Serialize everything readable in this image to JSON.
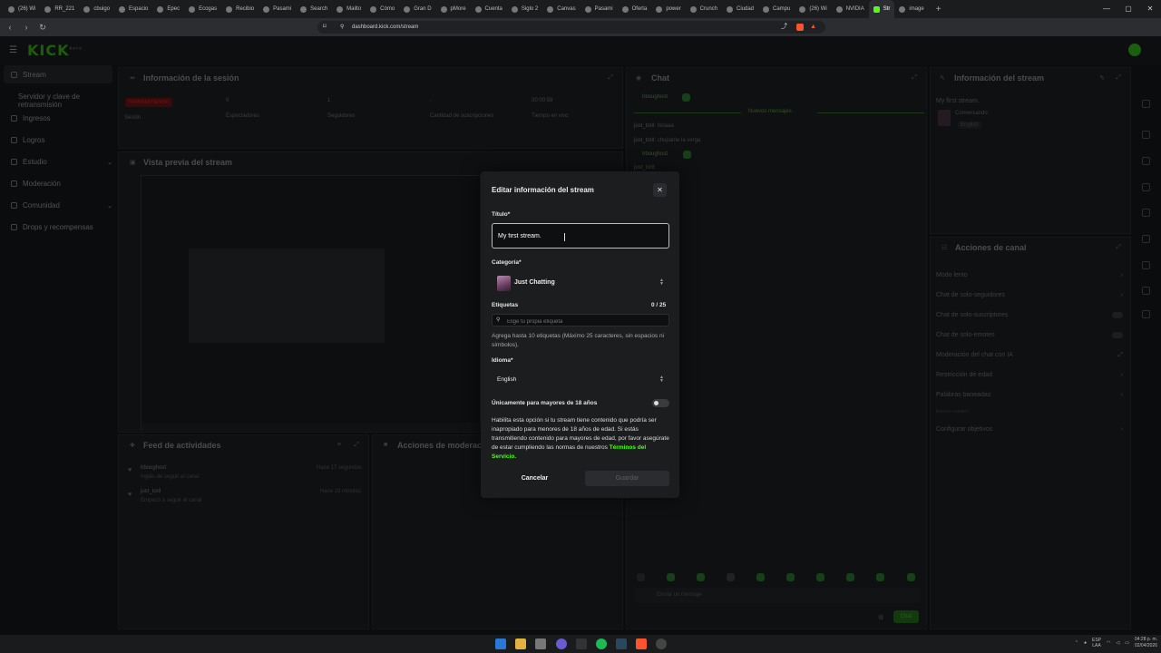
{
  "browser": {
    "tabs": [
      "(26) Wi",
      "RR_221",
      "cbuigo",
      "Espacio",
      "Epec",
      "Ecogas",
      "Recibio",
      "Pasami",
      "Search",
      "Mailto",
      "Cómo",
      "Gran D",
      "pMore",
      "Cuenta",
      "Siglo 2",
      "Canvas",
      "Pasami",
      "Oferta",
      "power",
      "Crunch",
      "Ciudad",
      "Campu",
      "(26) Wi",
      "NVIDIA",
      "Str",
      "image"
    ],
    "active_tab_index": 24,
    "url": "dashboard.kick.com/stream",
    "window_controls": [
      "—",
      "▢",
      "✕"
    ]
  },
  "kick": {
    "logo": "KICK",
    "logo_badge": "beta"
  },
  "sidebar": {
    "items": [
      {
        "label": "Stream",
        "icon": "broadcast-icon"
      },
      {
        "label": "Servidor y clave de retransmisión",
        "icon": ""
      },
      {
        "label": "Ingresos",
        "icon": "money-icon"
      },
      {
        "label": "Logros",
        "icon": "trophy-icon"
      },
      {
        "label": "Estudio",
        "icon": "studio-icon"
      },
      {
        "label": "Moderación",
        "icon": "shield-icon"
      },
      {
        "label": "Comunidad",
        "icon": "users-icon"
      },
      {
        "label": "Drops y recompensas",
        "icon": "gift-icon"
      }
    ]
  },
  "session": {
    "title": "Información de la sesión",
    "live_badge": "TRANSMITIENDO",
    "stats": [
      {
        "value": "",
        "label": "Sesión"
      },
      {
        "value": "0",
        "label": "Espectadores"
      },
      {
        "value": "1",
        "label": "Seguidores"
      },
      {
        "value": "-",
        "label": "Cantidad de suscripciones"
      },
      {
        "value": "00:00:58",
        "label": "Tiempo en vivo"
      }
    ]
  },
  "preview": {
    "title": "Vista previa del stream"
  },
  "activity": {
    "title": "Feed de actividades",
    "items": [
      {
        "user": "lrboughost",
        "desc": "Inglés de seguir al canal",
        "time": "Hace 17 segundos"
      },
      {
        "user": "just_toril",
        "desc": "Empezó a seguir el canal",
        "time": "Hace 19 minutos"
      }
    ]
  },
  "mod_actions": {
    "title": "Acciones de moderación"
  },
  "chat": {
    "title": "Chat",
    "user1": "lrboughost",
    "new_messages": "Nuevos mensajes",
    "lines": [
      {
        "user": "just_toril:",
        "text": "holaaa"
      },
      {
        "user": "just_toril:",
        "text": "chupame la verga"
      }
    ],
    "user2": "lrboughost",
    "user3": "just_toril:",
    "input_placeholder": "Enviar un mensaje",
    "send": "Chat"
  },
  "stream_info": {
    "title": "Información del stream",
    "stream_title": "My first stream.",
    "category": "Conversando",
    "language": "English"
  },
  "channel_actions": {
    "title": "Acciones de canal",
    "items": [
      "Modo lento",
      "Chat de solo-seguidores",
      "Chat de solo-suscriptores",
      "Chat de solo-emotes",
      "Moderación del chat con IA",
      "Restricción de edad",
      "Palabras baneadas",
      "Nuevos canales",
      "Configurar objetivos"
    ]
  },
  "modal": {
    "title": "Editar información del stream",
    "title_label": "Título*",
    "title_value": "My first stream.",
    "category_label": "Categoría*",
    "category_value": "Just Chatting",
    "tags_label": "Etiquetas",
    "tags_count": "0 / 25",
    "tags_placeholder": "Elige tu propia etiqueta",
    "tags_help": "Agrega hasta 10 etiquetas (Máximo 25 caracteres, sin espacios ni símbolos).",
    "language_label": "Idioma*",
    "language_value": "English",
    "adult_label": "Únicamente para mayores de 18 años",
    "adult_enabled": false,
    "adult_help": "Habilita esta opción si tu stream tiene contenido que podría ser inapropiado para menores de 18 años de edad. Si estás transmitiendo contenido para mayores de edad, por favor asegúrate de estar cumpliendo las normas de nuestros",
    "tos_link": "Términos del Servicio.",
    "cancel": "Cancelar",
    "save": "Guardar"
  },
  "taskbar": {
    "lang": "ESP",
    "lang2": "LAA",
    "time": "04:28 p. m.",
    "date": "02/04/2026"
  },
  "colors": {
    "accent": "#53fc18",
    "modal_bg": "#1c1d1f",
    "page_bg": "#0b0c0d",
    "live": "#eb0400"
  }
}
